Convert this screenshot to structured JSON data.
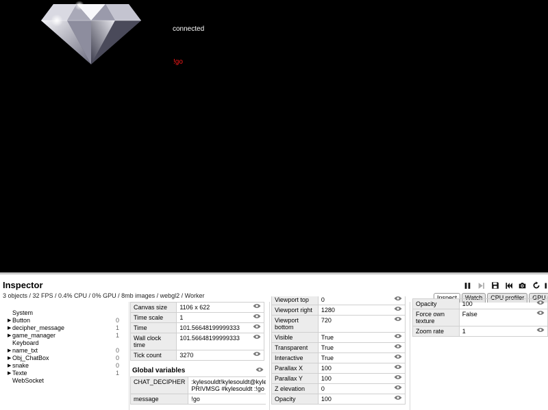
{
  "game": {
    "status_text": "connected",
    "message_text": "!go"
  },
  "inspector": {
    "title": "Inspector",
    "stats": "3 objects / 32 FPS / 0.4% CPU / 0% GPU / 8mb images / webgl2 / Worker",
    "tabs": [
      {
        "label": "Inspect",
        "active": true
      },
      {
        "label": "Watch",
        "active": false
      },
      {
        "label": "CPU profiler",
        "active": false
      },
      {
        "label": "GPU profil",
        "active": false
      }
    ],
    "tree": [
      {
        "label": "System",
        "count": "",
        "expandable": false
      },
      {
        "label": "Button",
        "count": "0",
        "expandable": true
      },
      {
        "label": "decipher_message",
        "count": "1",
        "expandable": true
      },
      {
        "label": "game_manager",
        "count": "1",
        "expandable": true
      },
      {
        "label": "Keyboard",
        "count": "",
        "expandable": false
      },
      {
        "label": "name_txt",
        "count": "0",
        "expandable": true
      },
      {
        "label": "Obj_ChatBox",
        "count": "0",
        "expandable": true
      },
      {
        "label": "snake",
        "count": "0",
        "expandable": true
      },
      {
        "label": "Texte",
        "count": "1",
        "expandable": true
      },
      {
        "label": "WebSocket",
        "count": "",
        "expandable": false
      }
    ],
    "system_props": [
      {
        "label": "Canvas size",
        "value": "1106 x 622"
      },
      {
        "label": "Time scale",
        "value": "1"
      },
      {
        "label": "Time",
        "value": "101.56648199999333"
      },
      {
        "label": "Wall clock time",
        "value": "101.56648199999333"
      },
      {
        "label": "Tick count",
        "value": "3270"
      }
    ],
    "global_vars_title": "Global variables",
    "global_vars": [
      {
        "label": "CHAT_DECIPHER",
        "value": ":kylesouldt!kylesouldt@kylesouldt.tmi.twitch.tv PRIVMSG #kylesouldt :!go"
      },
      {
        "label": "message",
        "value": "!go"
      }
    ],
    "layer_props": [
      {
        "label": "Viewport top",
        "value": "0"
      },
      {
        "label": "Viewport right",
        "value": "1280"
      },
      {
        "label": "Viewport bottom",
        "value": "720"
      },
      {
        "label": "Visible",
        "value": "True"
      },
      {
        "label": "Transparent",
        "value": "True"
      },
      {
        "label": "Interactive",
        "value": "True"
      },
      {
        "label": "Parallax X",
        "value": "100"
      },
      {
        "label": "Parallax Y",
        "value": "100"
      },
      {
        "label": "Z elevation",
        "value": "0"
      },
      {
        "label": "Opacity",
        "value": "100"
      }
    ],
    "layout_props": [
      {
        "label": "Opacity",
        "value": "100"
      },
      {
        "label": "Force own texture",
        "value": "False"
      },
      {
        "label": "Zoom rate",
        "value": "1"
      }
    ]
  }
}
